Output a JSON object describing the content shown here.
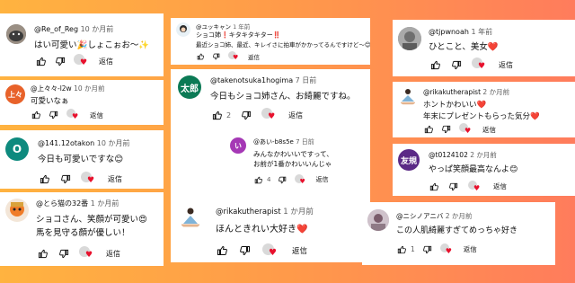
{
  "reply_label": "返信",
  "colors": {
    "heart": "#e8112d",
    "time": "#606060",
    "text": "#0f0f0f"
  },
  "comments": [
    {
      "user": "@Re_of_Reg",
      "time": "10 か月前",
      "text": "はい可愛い🎉しょこぉお〜✨",
      "likes": "",
      "avatar": "cat-photo"
    },
    {
      "user": "@上々々-l2w",
      "time": "10 か月前",
      "text": "可愛いなぁ",
      "likes": "",
      "avatar_text": "上々",
      "avatar_color": "#e8622a"
    },
    {
      "user": "@141.12otakon",
      "time": "10 か月前",
      "text": "今日も可愛いですな😊",
      "likes": "",
      "avatar_text": "O",
      "avatar_color": "#0e8a7e"
    },
    {
      "user": "@とら猫の32番",
      "time": "1 か月前",
      "text": "ショコさん、笑顔が可愛い😍",
      "text2": "馬を見守る顔が優しい！",
      "likes": "",
      "avatar": "mascot-illustration"
    },
    {
      "user": "@ユッキャン",
      "time": "1 年前",
      "text": "ショコ姉❗キタキタキター‼️",
      "text2": "最近ショコ姉、最近、キレイさに拍車がかかってるんですけど〜😊",
      "likes": "",
      "avatar": "cartoon-avatar"
    },
    {
      "user": "@takenotsuka1hogima",
      "time": "7 日前",
      "text": "今日もショコ姉さん、お綺麗ですね。",
      "likes": "2",
      "avatar_text": "太郎",
      "avatar_color": "#0b7a55"
    },
    {
      "user": "@あい-b8s5e",
      "time": "7 日前",
      "text": "みんなかわいいですって、",
      "text2": "お前が1番かわいいんじゃ",
      "likes": "4",
      "avatar_text": "い",
      "avatar_color": "#a538b5"
    },
    {
      "user": "@rikakutherapist",
      "time": "1 か月前",
      "text": "ほんときれい大好き❤️",
      "likes": "",
      "avatar": "yoga-illustration"
    },
    {
      "user": "@tjpwnoah",
      "time": "1 年前",
      "text": "ひとこと、美女❤️",
      "likes": "",
      "avatar": "gray-photo"
    },
    {
      "user": "@rikakutherapist",
      "time": "2 か月前",
      "text": "ホントかわいい❤️",
      "text2": "年末にプレゼントもらった気分❤️",
      "likes": "",
      "avatar": "yoga-illustration"
    },
    {
      "user": "@t0124102",
      "time": "2 か月前",
      "text": "やっぱ笑顔最高なんよ😊",
      "likes": "",
      "avatar_text": "友規",
      "avatar_color": "#5b2a86"
    },
    {
      "user": "@ニシノアニバ",
      "time": "2 か月前",
      "text": "この人肌綺麗すぎてめっちゃ好き",
      "likes": "1",
      "avatar": "photo-avatar"
    }
  ]
}
